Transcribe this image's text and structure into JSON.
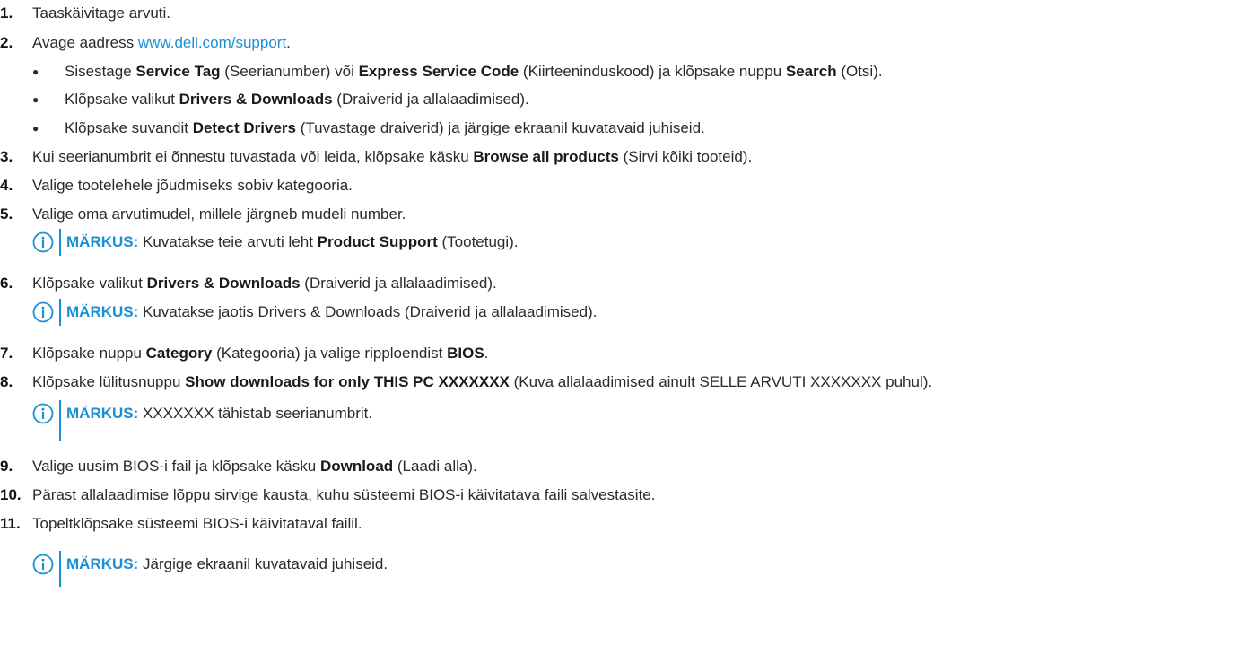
{
  "steps": [
    {
      "num": "1.",
      "text": "Taaskäivitage arvuti."
    },
    {
      "num": "2.",
      "text": "Avage aadress ",
      "link": "www.dell.com/support",
      "after": "."
    },
    {
      "num": "3.",
      "pre": "Kui seerianumbrit ei õnnestu tuvastada või leida, klõpsake käsku ",
      "bold": "Browse all products",
      "post": " (Sirvi kõiki tooteid)."
    },
    {
      "num": "4.",
      "text": "Valige tootelehele jõudmiseks sobiv kategooria."
    },
    {
      "num": "5.",
      "text": "Valige oma arvutimudel, millele järgneb mudeli number."
    },
    {
      "num": "6.",
      "pre": "Klõpsake valikut ",
      "bold": "Drivers & Downloads",
      "post": " (Draiverid ja allalaadimised)."
    },
    {
      "num": "7.",
      "pre": "Klõpsake nuppu ",
      "bold": "Category",
      "mid": " (Kategooria) ja valige ripploendist ",
      "bold2": "BIOS",
      "post": "."
    },
    {
      "num": "8.",
      "pre": "Klõpsake lülitusnuppu ",
      "bold": "Show downloads for only THIS PC XXXXXXX",
      "post": " (Kuva allalaadimised ainult SELLE ARVUTI XXXXXXX puhul)."
    },
    {
      "num": "9.",
      "pre": "Valige uusim BIOS-i fail ja klõpsake käsku ",
      "bold": "Download",
      "post": " (Laadi alla)."
    },
    {
      "num": "10.",
      "text": "Pärast allalaadimise lõppu sirvige kausta, kuhu süsteemi BIOS-i käivitatava faili salvestasite."
    },
    {
      "num": "11.",
      "text": "Topeltklõpsake süsteemi BIOS-i käivitataval failil."
    }
  ],
  "bullets": [
    {
      "pre": "Sisestage ",
      "bold": "Service Tag",
      "mid": " (Seerianumber) või ",
      "bold2": "Express Service Code",
      "mid2": " (Kiirteeninduskood) ja klõpsake nuppu ",
      "bold3": "Search",
      "post": " (Otsi)."
    },
    {
      "pre": "Klõpsake valikut ",
      "bold": "Drivers & Downloads",
      "post": " (Draiverid ja allalaadimised)."
    },
    {
      "pre": "Klõpsake suvandit ",
      "bold": "Detect Drivers",
      "post": " (Tuvastage draiverid) ja järgige ekraanil kuvatavaid juhiseid."
    }
  ],
  "bullet_symbol": "●",
  "notes": [
    {
      "label": "MÄRKUS:",
      "pre": " Kuvatakse teie arvuti leht ",
      "bold": "Product Support",
      "post": " (Tootetugi)."
    },
    {
      "label": "MÄRKUS:",
      "text": " Kuvatakse jaotis Drivers & Downloads (Draiverid ja allalaadimised)."
    },
    {
      "label": "MÄRKUS:",
      "text": " XXXXXXX tähistab seerianumbrit."
    },
    {
      "label": "MÄRKUS:",
      "text": " Järgige ekraanil kuvatavaid juhiseid."
    }
  ],
  "accent_color": "#1a8fd6"
}
